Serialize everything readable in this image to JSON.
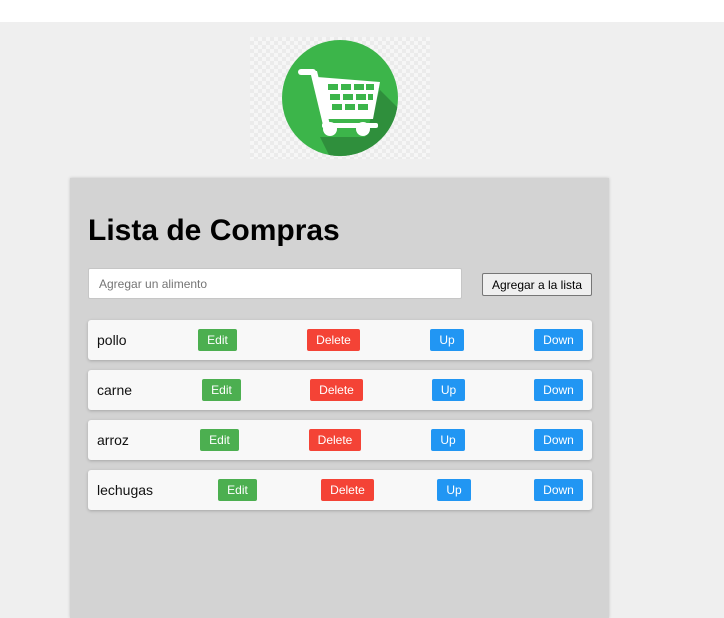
{
  "logo": {
    "icon": "shopping-cart-icon",
    "circle_color": "#3cb54a",
    "shadow_color": "#2f8f3c"
  },
  "title": "Lista de Compras",
  "add_form": {
    "placeholder": "Agregar un alimento",
    "value": "",
    "button_label": "Agregar a la lista"
  },
  "colors": {
    "edit": "#4caf50",
    "delete": "#f44336",
    "up": "#2196f3",
    "down": "#2196f3"
  },
  "items": [
    {
      "label": "pollo",
      "edit": "Edit",
      "delete": "Delete",
      "up": "Up",
      "down": "Down"
    },
    {
      "label": "carne",
      "edit": "Edit",
      "delete": "Delete",
      "up": "Up",
      "down": "Down"
    },
    {
      "label": "arroz",
      "edit": "Edit",
      "delete": "Delete",
      "up": "Up",
      "down": "Down"
    },
    {
      "label": "lechugas",
      "edit": "Edit",
      "delete": "Delete",
      "up": "Up",
      "down": "Down"
    }
  ]
}
